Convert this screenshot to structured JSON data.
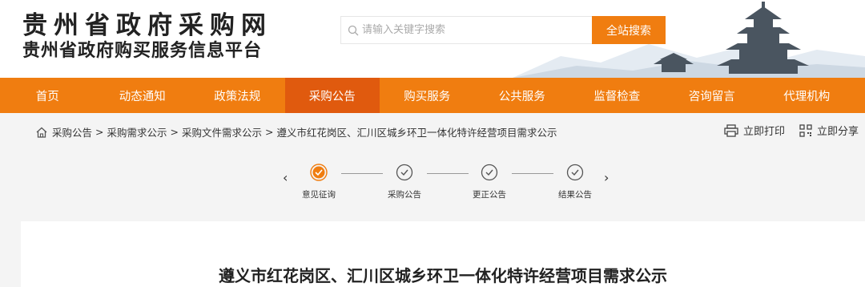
{
  "header": {
    "site_name": "贵州省政府采购网",
    "platform_name": "贵州省政府购买服务信息平台",
    "search": {
      "placeholder": "请输入关键字搜索",
      "button_label": "全站搜索"
    }
  },
  "nav": {
    "items": [
      {
        "label": "首页"
      },
      {
        "label": "动态通知"
      },
      {
        "label": "政策法规"
      },
      {
        "label": "采购公告"
      },
      {
        "label": "购买服务"
      },
      {
        "label": "公共服务"
      },
      {
        "label": "监督检查"
      },
      {
        "label": "咨询留言"
      },
      {
        "label": "代理机构"
      }
    ],
    "active": "采购公告"
  },
  "breadcrumb": {
    "items": [
      "采购公告",
      "采购需求公示",
      "采购文件需求公示",
      "遵义市红花岗区、汇川区城乡环卫一体化特许经营项目需求公示"
    ],
    "separator": ">"
  },
  "actions": {
    "print_label": "立即打印",
    "share_label": "立即分享"
  },
  "steps": {
    "prev_arrow": "‹",
    "next_arrow": "›",
    "items": [
      {
        "label": "意见征询",
        "current": true
      },
      {
        "label": "采购公告",
        "current": false
      },
      {
        "label": "更正公告",
        "current": false
      },
      {
        "label": "结果公告",
        "current": false
      }
    ]
  },
  "document": {
    "title": "遵义市红花岗区、汇川区城乡环卫一体化特许经营项目需求公示"
  },
  "colors": {
    "accent": "#f07d10",
    "nav_active": "#e05a0e"
  }
}
